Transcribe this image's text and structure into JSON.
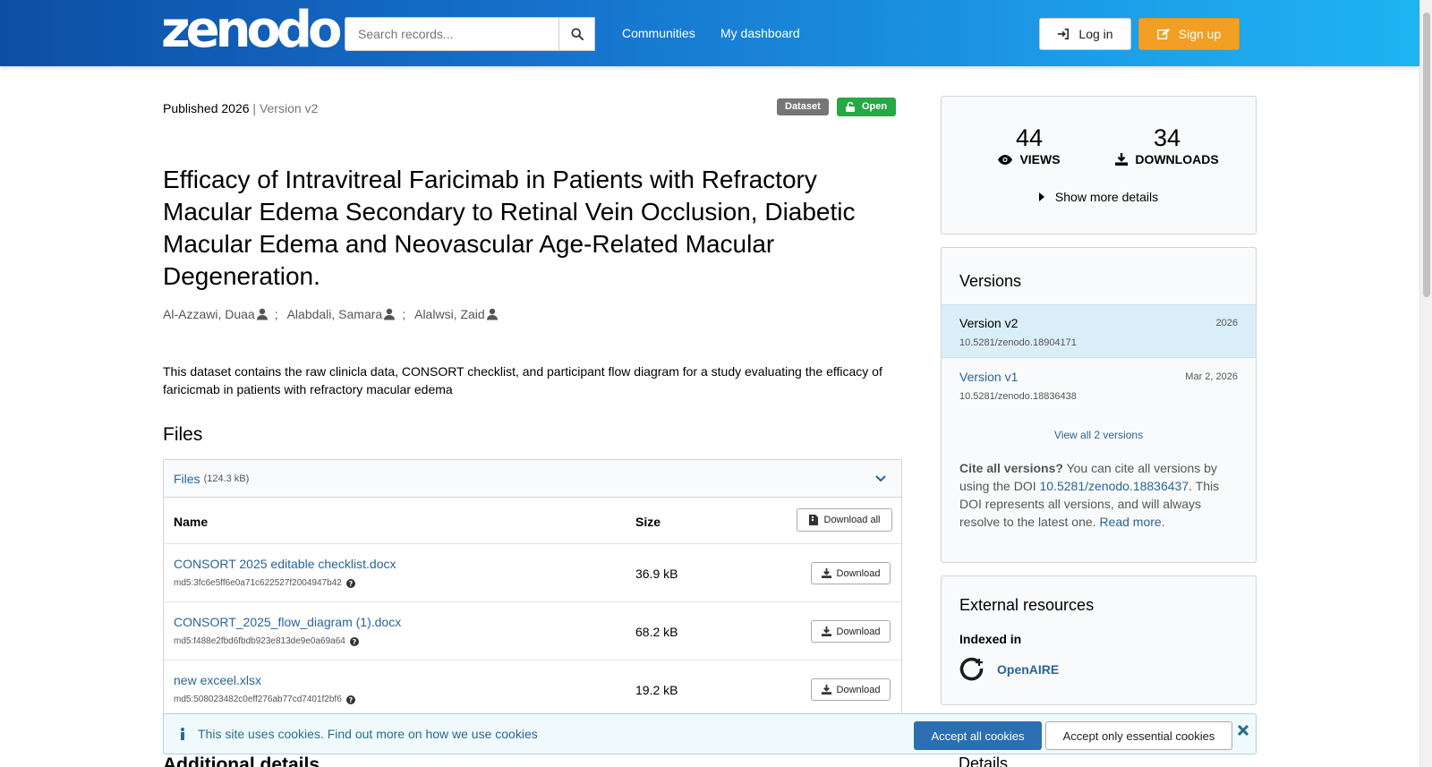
{
  "header": {
    "logo": "zenodo",
    "search_placeholder": "Search records...",
    "nav": [
      "Communities",
      "My dashboard"
    ],
    "login": "Log in",
    "signup": "Sign up"
  },
  "record": {
    "published": "Published 2026",
    "version": "| Version v2",
    "badge_type": "Dataset",
    "badge_access": "Open",
    "title": "Efficacy of Intravitreal Faricimab in Patients with Refractory Macular Edema Secondary to Retinal Vein Occlusion, Diabetic Macular Edema and Neovascular Age-Related Macular Degeneration.",
    "authors": [
      "Al-Azzawi, Duaa",
      "Alabdali, Samara",
      "Alalwsi, Zaid"
    ],
    "author_separator": ";",
    "description": "This dataset contains the raw clinicla data, CONSORT checklist, and participant flow diagram for a study evaluating the efficacy of faricicmab in patients with refractory macular edema"
  },
  "files": {
    "heading": "Files",
    "panel_label": "Files",
    "panel_size": "(124.3 kB)",
    "col_name": "Name",
    "col_size": "Size",
    "download_all": "Download all",
    "download_label": "Download",
    "items": [
      {
        "name": "CONSORT 2025 editable checklist.docx",
        "md5": "md5:3fc6e5ff6e0a71c622527f2004947b42",
        "size": "36.9 kB"
      },
      {
        "name": "CONSORT_2025_flow_diagram (1).docx",
        "md5": "md5:f488e2fbd6fbdb923e813de9e0a69a64",
        "size": "68.2 kB"
      },
      {
        "name": "new exceel.xlsx",
        "md5": "md5:508023482c0eff276ab77cd7401f2bf6",
        "size": "19.2 kB"
      }
    ]
  },
  "additional_heading": "Additional details",
  "stats": {
    "views": "44",
    "views_label": "VIEWS",
    "downloads": "34",
    "downloads_label": "DOWNLOADS",
    "show_more": "Show more details"
  },
  "versions": {
    "heading": "Versions",
    "items": [
      {
        "name": "Version v2",
        "date": "2026",
        "doi": "10.5281/zenodo.18904171"
      },
      {
        "name": "Version v1",
        "date": "Mar 2, 2026",
        "doi": "10.5281/zenodo.18836438"
      }
    ],
    "view_all": "View all 2 versions",
    "cite_bold": "Cite all versions?",
    "cite_text1": " You can cite all versions by using the DOI ",
    "cite_doi": "10.5281/zenodo.18836437",
    "cite_text2": ". This DOI represents all versions, and will always resolve to the latest one. ",
    "read_more": "Read more."
  },
  "external": {
    "heading": "External resources",
    "indexed_in": "Indexed in",
    "openaire": "OpenAIRE"
  },
  "details_heading": "Details",
  "cookie": {
    "text": "This site uses cookies. Find out more on ",
    "link": "how we use cookies",
    "accept_all": "Accept all cookies",
    "accept_essential": "Accept only essential cookies"
  }
}
